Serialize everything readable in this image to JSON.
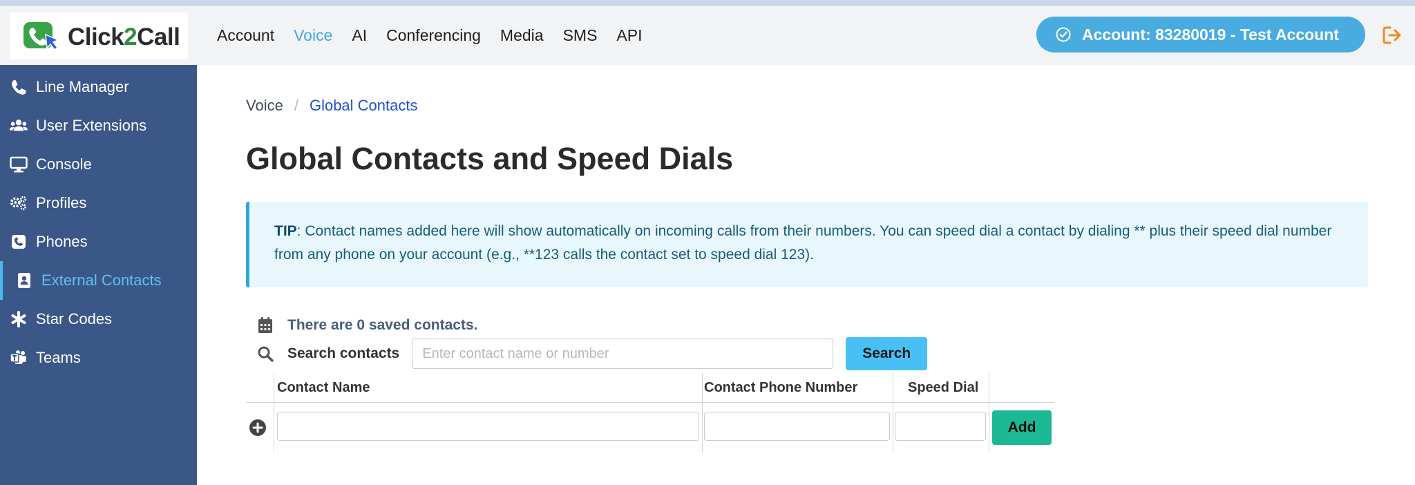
{
  "header": {
    "logo_text_a": "Click",
    "logo_text_b": "2",
    "logo_text_c": "Call",
    "nav": [
      {
        "label": "Account",
        "active": false
      },
      {
        "label": "Voice",
        "active": true
      },
      {
        "label": "AI",
        "active": false
      },
      {
        "label": "Conferencing",
        "active": false
      },
      {
        "label": "Media",
        "active": false
      },
      {
        "label": "SMS",
        "active": false
      },
      {
        "label": "API",
        "active": false
      }
    ],
    "account_label": "Account:  83280019  -  Test Account",
    "icons": {
      "account_check": "check-circle-icon",
      "logout": "sign-out-icon"
    }
  },
  "sidebar": {
    "items": [
      {
        "label": "Line Manager",
        "icon": "phone-icon"
      },
      {
        "label": "User Extensions",
        "icon": "users-icon"
      },
      {
        "label": "Console",
        "icon": "desktop-icon"
      },
      {
        "label": "Profiles",
        "icon": "cogs-icon"
      },
      {
        "label": "Phones",
        "icon": "phone-square-icon"
      },
      {
        "label": "External Contacts",
        "icon": "address-book-icon",
        "active": true
      },
      {
        "label": "Star Codes",
        "icon": "asterisk-icon"
      },
      {
        "label": "Teams",
        "icon": "teams-icon"
      }
    ]
  },
  "breadcrumb": {
    "parent": "Voice",
    "separator": "/",
    "current": "Global Contacts"
  },
  "page_title": "Global Contacts and Speed Dials",
  "tip": {
    "label": "TIP",
    "text": ": Contact names added here will show automatically on incoming calls from their numbers. You can speed dial a contact by dialing ** plus their speed dial number from any phone on your account (e.g., **123 calls the contact set to speed dial 123)."
  },
  "contacts": {
    "saved_text": "There are 0 saved contacts.",
    "search_label": "Search contacts",
    "search_placeholder": "Enter contact name or number",
    "search_value": "",
    "search_button": "Search"
  },
  "table": {
    "headers": [
      "Contact Name",
      "Contact Phone Number",
      "Speed Dial"
    ],
    "new_row": {
      "name": "",
      "phone": "",
      "speed_dial": ""
    },
    "add_button": "Add"
  },
  "colors": {
    "sidebar_bg": "#3a5788",
    "accent_blue": "#49ace0",
    "active_link": "#3fa9e0",
    "tip_bg": "#e8f7fc",
    "add_green": "#1db894",
    "logout_orange": "#f08a24"
  }
}
